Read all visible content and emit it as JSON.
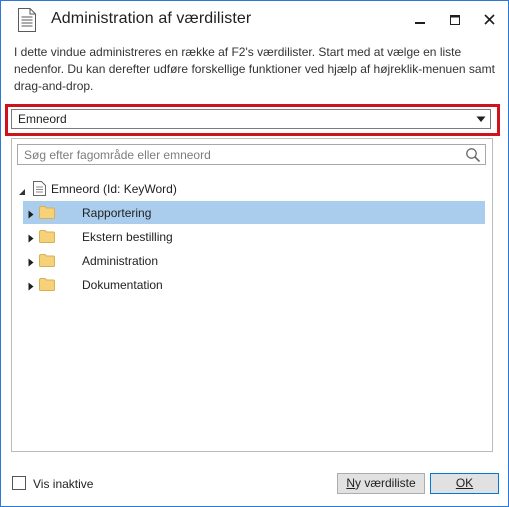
{
  "window": {
    "title": "Administration af værdilister",
    "icons": {
      "app": "document-list-icon",
      "minimize": "minimize-icon",
      "maximize": "maximize-icon",
      "close": "close-icon"
    }
  },
  "description": "I dette vindue administreres en række af F2's værdilister. Start med at vælge en liste nedenfor. Du kan derefter udføre forskellige funktioner ved hjælp af højreklik-menuen samt drag-and-drop.",
  "list_selector": {
    "selected": "Emneord",
    "highlight_color": "#d0131b"
  },
  "search": {
    "placeholder": "Søg efter fagområde eller emneord",
    "value": ""
  },
  "tree": {
    "root": {
      "label": "Emneord (Id: KeyWord)",
      "expanded": true
    },
    "items": [
      {
        "label": "Rapportering",
        "selected": true
      },
      {
        "label": "Ekstern bestilling",
        "selected": false
      },
      {
        "label": "Administration",
        "selected": false
      },
      {
        "label": "Dokumentation",
        "selected": false
      }
    ]
  },
  "footer": {
    "show_inactive": {
      "label": "Vis inaktive",
      "checked": false
    },
    "new_list_button": {
      "label_underlined": "N",
      "label_rest": "y værdiliste"
    },
    "ok_button": {
      "label": "OK"
    }
  },
  "colors": {
    "selection": "#aacdee",
    "folder": "#f5d27a",
    "window_border": "#2b78d6"
  }
}
